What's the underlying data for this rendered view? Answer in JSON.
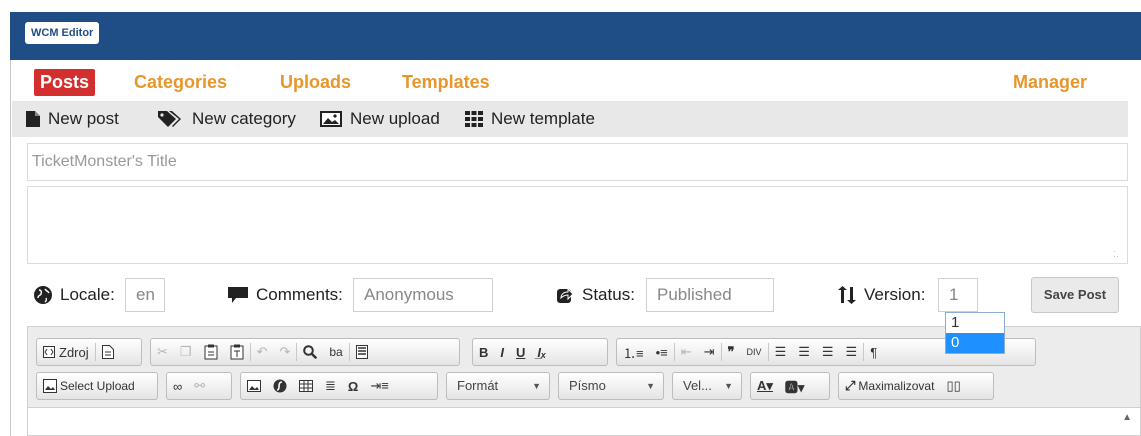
{
  "app": {
    "badge": "WCM Editor"
  },
  "nav": {
    "posts": "Posts",
    "categories": "Categories",
    "uploads": "Uploads",
    "templates": "Templates",
    "manager": "Manager"
  },
  "actions": {
    "new_post": "New post",
    "new_category": "New category",
    "new_upload": "New upload",
    "new_template": "New template"
  },
  "editor": {
    "title_placeholder": "TicketMonster's Title"
  },
  "meta": {
    "locale_label": "Locale:",
    "locale_value": "en",
    "comments_label": "Comments:",
    "comments_value": "Anonymous",
    "status_label": "Status:",
    "status_value": "Published",
    "version_label": "Version:",
    "version_value": "1",
    "save_label": "Save Post"
  },
  "version_dropdown": {
    "options": [
      "1",
      "0"
    ],
    "highlighted": "0"
  },
  "toolbar": {
    "source_label": "Zdroj",
    "select_upload_label": "Select Upload",
    "format_label": "Formát",
    "font_label": "Písmo",
    "size_label": "Vel...",
    "maximize_label": "Maximalizovat"
  },
  "colors": {
    "brand_blue": "#1f4e86",
    "nav_orange": "#e8962c",
    "active_red": "#d32f2f",
    "selection_blue": "#1e90ff"
  }
}
